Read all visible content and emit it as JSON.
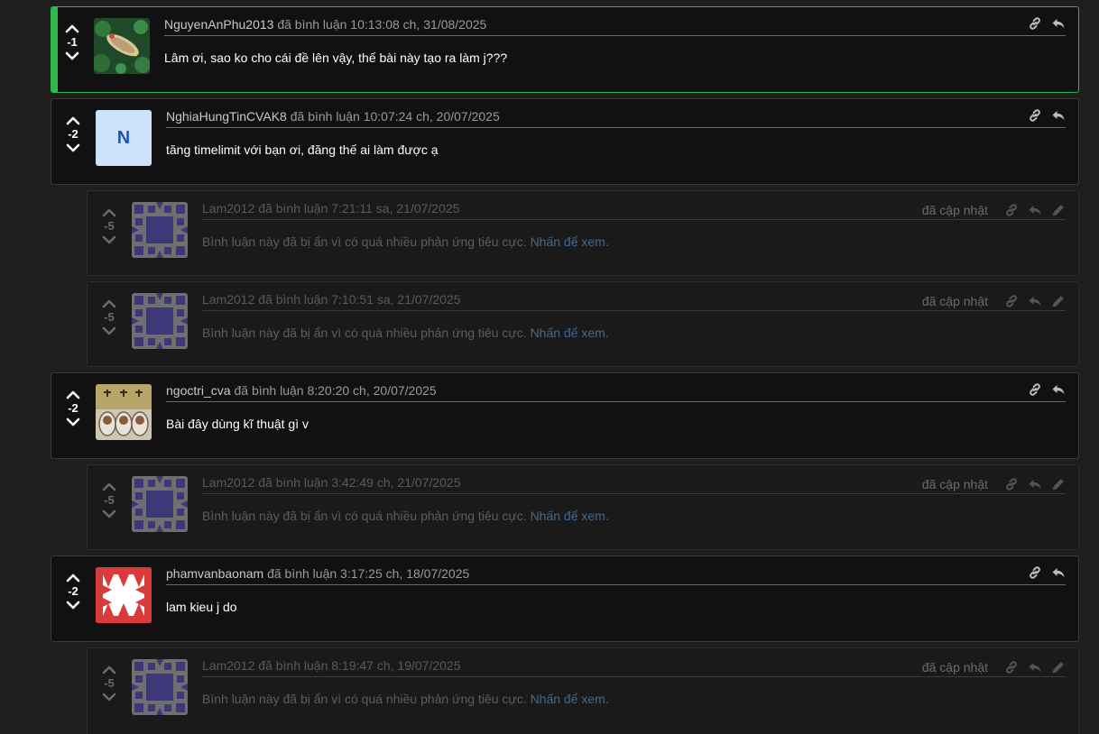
{
  "verb": "đã bình luận",
  "updated_label": "đã cập nhật",
  "hidden_text": "Bình luận này đã bị ẩn vì có quá nhiều phản ứng tiêu cực.",
  "reveal_link": "Nhấn để xem.",
  "colors": {
    "accent_green": "#2fb84f",
    "link_blue": "#3f6a8e",
    "background": "#1e1e1e",
    "card": "#111111"
  },
  "icons": {
    "upvote": "chevron-up-icon",
    "downvote": "chevron-down-icon",
    "permalink": "link-icon",
    "reply": "reply-icon",
    "edit": "pencil-icon"
  },
  "comments": [
    {
      "user": "NguyenAnPhu2013",
      "time": "10:13:08 ch, 31/08/2025",
      "score": "-1",
      "text": "Lâm ơi, sao ko cho cái đề lên vậy, thế bài này tạo ra làm j???"
    },
    {
      "user": "NghiaHungTinCVAK8",
      "time": "10:07:24 ch, 20/07/2025",
      "score": "-2",
      "text": "tăng timelimit với bạn ơi, đăng thế ai làm được ạ",
      "avatar_letter": "N"
    },
    {
      "user": "Lam2012",
      "time": "7:21:11 sa, 21/07/2025",
      "score": "-5"
    },
    {
      "user": "Lam2012",
      "time": "7:10:51 sa, 21/07/2025",
      "score": "-5"
    },
    {
      "user": "ngoctri_cva",
      "time": "8:20:20 ch, 20/07/2025",
      "score": "-2",
      "text": "Bài đây dùng kĩ thuật gì v"
    },
    {
      "user": "Lam2012",
      "time": "3:42:49 ch, 21/07/2025",
      "score": "-5"
    },
    {
      "user": "phamvanbaonam",
      "time": "3:17:25 ch, 18/07/2025",
      "score": "-2",
      "text": "lam kieu j do"
    },
    {
      "user": "Lam2012",
      "time": "8:19:47 ch, 19/07/2025",
      "score": "-5"
    }
  ]
}
